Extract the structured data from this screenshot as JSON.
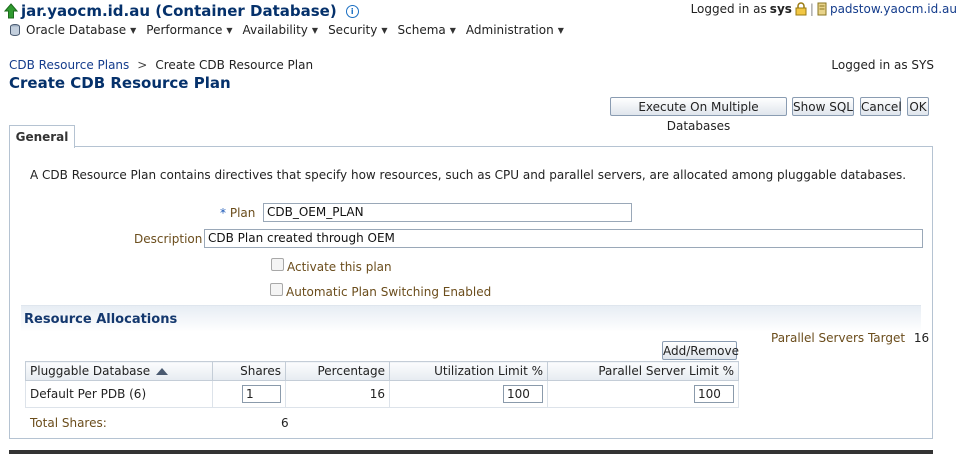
{
  "header": {
    "title": "jar.yaocm.id.au (Container Database)",
    "logged_in_prefix": "Logged in as",
    "user": "sys",
    "host_link": "padstow.yaocm.id.au"
  },
  "menu": [
    {
      "label": "Oracle Database"
    },
    {
      "label": "Performance"
    },
    {
      "label": "Availability"
    },
    {
      "label": "Security"
    },
    {
      "label": "Schema"
    },
    {
      "label": "Administration"
    }
  ],
  "breadcrumb": {
    "parent": "CDB Resource Plans",
    "separator": ">",
    "current": "Create CDB Resource Plan"
  },
  "page": {
    "title": "Create CDB Resource Plan",
    "logged_in": "Logged in as SYS"
  },
  "buttons": {
    "execute": "Execute On Multiple Databases",
    "show_sql": "Show SQL",
    "cancel": "Cancel",
    "ok": "OK"
  },
  "tab": {
    "general": "General"
  },
  "form": {
    "description_text": "A CDB Resource Plan contains directives that specify how resources, such as CPU and parallel servers, are allocated among pluggable databases.",
    "plan_required": "*",
    "plan_label": "Plan",
    "plan_value": "CDB_OEM_PLAN",
    "description_label": "Description",
    "description_value": "CDB Plan created through OEM",
    "activate_label": "Activate this plan",
    "activate_checked": false,
    "auto_switch_label": "Automatic Plan Switching Enabled",
    "auto_switch_checked": false
  },
  "resource_allocations": {
    "title": "Resource Allocations",
    "parallel_target_label": "Parallel Servers Target",
    "parallel_target_value": "16",
    "add_remove": "Add/Remove",
    "columns": {
      "pdb": "Pluggable Database",
      "shares": "Shares",
      "percentage": "Percentage",
      "util_limit": "Utilization Limit %",
      "ps_limit": "Parallel Server Limit %"
    },
    "rows": [
      {
        "pdb": "Default Per PDB (6)",
        "shares": "1",
        "percentage": "16",
        "util_limit": "100",
        "ps_limit": "100"
      }
    ],
    "total_label": "Total Shares:",
    "total_value": "6"
  },
  "colors": {
    "title_blue": "#05316b",
    "label_brown": "#6b4d1c",
    "link_blue": "#143c8c"
  }
}
